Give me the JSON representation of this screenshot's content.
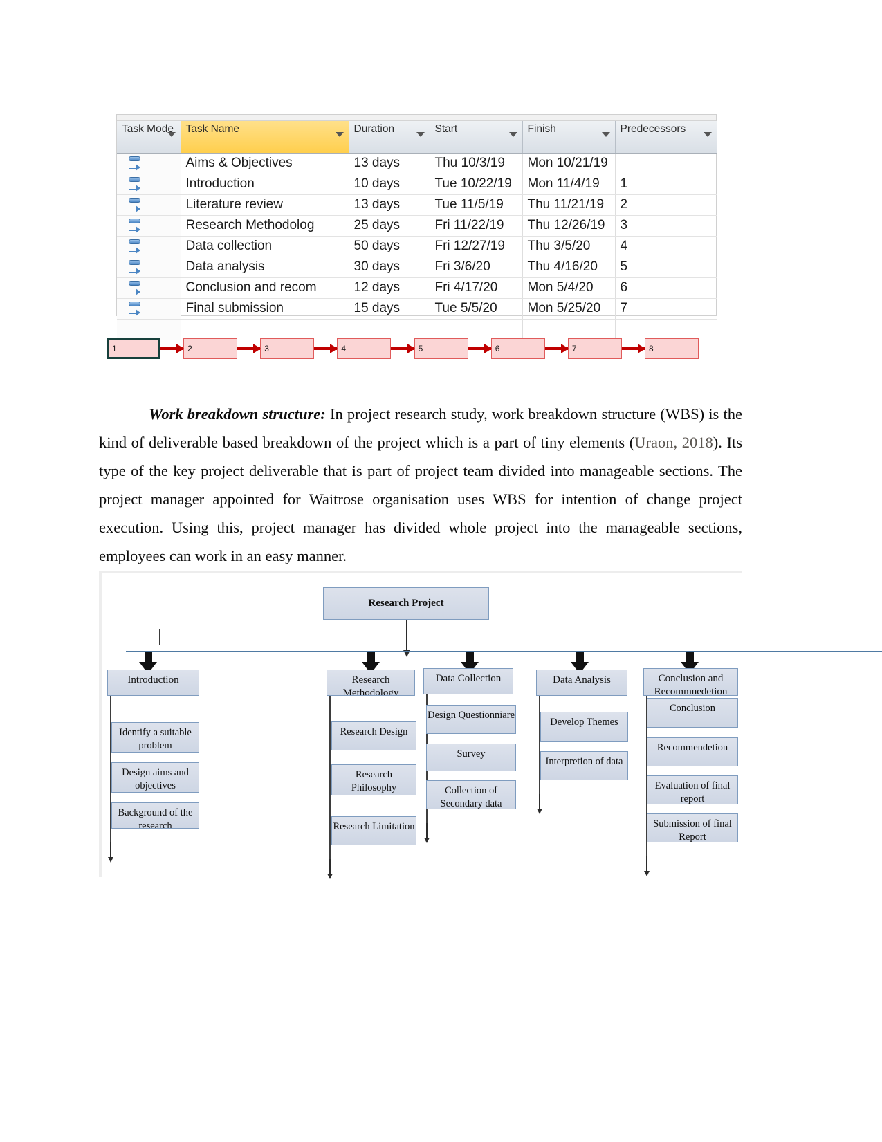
{
  "gantt": {
    "columns": [
      "Task Mode",
      "Task Name",
      "Duration",
      "Start",
      "Finish",
      "Predecessors"
    ],
    "rows": [
      {
        "mode": "auto-scheduled-icon",
        "name": "Aims & Objectives",
        "duration": "13 days",
        "start": "Thu 10/3/19",
        "finish": "Mon 10/21/19",
        "pred": ""
      },
      {
        "mode": "auto-scheduled-icon",
        "name": "Introduction",
        "duration": "10 days",
        "start": "Tue 10/22/19",
        "finish": "Mon 11/4/19",
        "pred": "1"
      },
      {
        "mode": "auto-scheduled-icon",
        "name": "Literature review",
        "duration": "13 days",
        "start": "Tue 11/5/19",
        "finish": "Thu 11/21/19",
        "pred": "2"
      },
      {
        "mode": "auto-scheduled-icon",
        "name": "Research Methodolog",
        "duration": "25 days",
        "start": "Fri 11/22/19",
        "finish": "Thu 12/26/19",
        "pred": "3"
      },
      {
        "mode": "auto-scheduled-icon",
        "name": "Data collection",
        "duration": "50 days",
        "start": "Fri 12/27/19",
        "finish": "Thu 3/5/20",
        "pred": "4"
      },
      {
        "mode": "auto-scheduled-icon",
        "name": "Data analysis",
        "duration": "30 days",
        "start": "Fri 3/6/20",
        "finish": "Thu 4/16/20",
        "pred": "5"
      },
      {
        "mode": "auto-scheduled-icon",
        "name": "Conclusion and recom",
        "duration": "12 days",
        "start": "Fri 4/17/20",
        "finish": "Mon 5/4/20",
        "pred": "6"
      },
      {
        "mode": "auto-scheduled-icon",
        "name": "Final submission",
        "duration": "15 days",
        "start": "Tue 5/5/20",
        "finish": "Mon 5/25/20",
        "pred": "7"
      }
    ]
  },
  "network": {
    "nodes": [
      "1",
      "2",
      "3",
      "4",
      "5",
      "6",
      "7",
      "8"
    ],
    "node_fill": "#fbd5d5",
    "node_border": "#e05b5b",
    "first_node_border": "#17403c",
    "link_color": "#c00000"
  },
  "paragraph": {
    "lead": "Work breakdown structure:",
    "t1": " In project research study, work breakdown structure (WBS) is the kind of deliverable based breakdown of the project which is a part of tiny elements (",
    "cite1": "Uraon, 2018",
    "t2": "). Its type of the key project deliverable that is part of project team divided into manageable sections. The project manager appointed for Waitrose organisation uses WBS for intention of change project execution. Using this, project manager has divided whole project into the manageable sections, employees can work in an easy manner."
  },
  "wbs": {
    "root": "Research Project",
    "box_fill": "#d6dce8",
    "box_border": "#7f9cbf",
    "branches": [
      {
        "title": "Introduction",
        "children": [
          "Identify a suitable problem",
          "Design aims and objectives",
          "Background of the research"
        ]
      },
      {
        "title": "Research Methodology",
        "children": [
          "Research Design",
          "Research Philosophy",
          "Research Limitation"
        ]
      },
      {
        "title": "Data Collection",
        "children": [
          "Design Questionniare",
          "Survey",
          "Collection of Secondary data"
        ]
      },
      {
        "title": "Data Analysis",
        "children": [
          "Develop Themes",
          "Interpretion of data"
        ]
      },
      {
        "title": "Conclusion and Recommnedetion",
        "children": [
          "Conclusion",
          "Recommendetion",
          "Evaluation of final report",
          "Submission of final Report"
        ]
      }
    ]
  }
}
